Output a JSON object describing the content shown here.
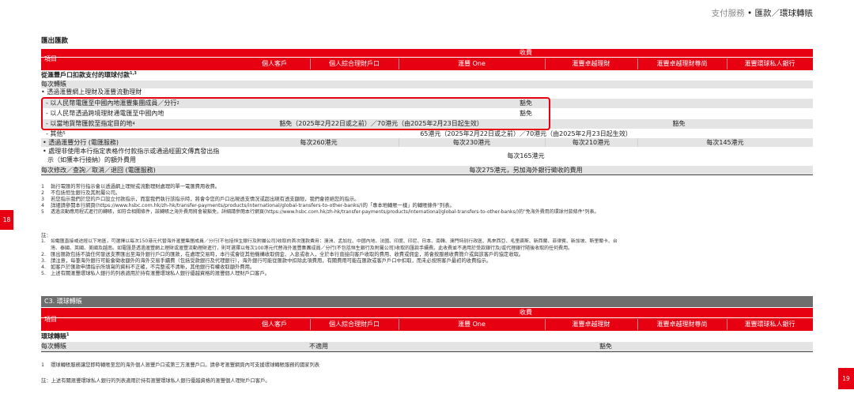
{
  "header": {
    "category": "支付服務",
    "bullet": "•",
    "title": "匯款／環球轉賬"
  },
  "page_numbers": {
    "left": "18",
    "right": "19"
  },
  "section1": {
    "title": "匯出匯款",
    "item_label": "項目",
    "fee_label": "收費",
    "columns": [
      "個人客戶",
      "個人綜合理財戶口",
      "滙豐 One",
      "滙豐卓越理財",
      "滙豐卓越理財尊尚",
      "滙豐環球私人銀行"
    ],
    "subheading": "從滙豐戶口扣款支付的環球付款",
    "subheading_sup": "1,3",
    "per_transfer": "每次轉賬",
    "online_line": "• 透過滙豐網上理財及滙豐流動理財",
    "rows": {
      "r1_label": "- 以人民幣電匯至中國內地滙豐集團成員／分行",
      "r1_sup": "2",
      "r1_value": "豁免",
      "r2_label": "- 以人民幣透過跨境理財通電匯至中國內地",
      "r2_value": "豁免",
      "r3_label": "- 以當地貨幣匯款至指定目的地",
      "r3_sup": "4",
      "r3_value_left": "豁免（2025年2月22日或之前）／70港元（由2025年2月23日起生效）",
      "r3_value_right": "豁免",
      "r4_label": "- 其他",
      "r4_sup": "5",
      "r4_value": "65港元（2025年2月22日或之前）／70港元（由2025年2月23日起生效）",
      "r5_label": "• 透過滙豐分行 (電匯服務)",
      "r5_v1": "每次260港元",
      "r5_v2": "每次230港元",
      "r5_v3": "每次210港元",
      "r5_v4": "每次145港元",
      "r6_label_1": "• 處理非使用本行指定表格作付款指示或通過經圖文傳真發出指",
      "r6_label_2": "示（如獲本行接納）的額外費用",
      "r6_value": "每次165港元",
      "r7_label": "每次修改／查詢／取消／退回 (電匯服務)",
      "r7_value": "每次275港元，另加海外銀行徵收的費用"
    },
    "footnotes": [
      {
        "n": "1",
        "text": "執行電匯的常行指示會以透過網上理財或流動理財處理的單一電匯費用收費。"
      },
      {
        "n": "2",
        "text": "不包括恒生銀行及其附屬公司。"
      },
      {
        "n": "3",
        "text": "若您指示我們於您的戶口設立付款指示，而當我們執行該指示時，將會令您的戶口出現透支情況或超出現有透支額限，我們會拒絕您的指示。"
      },
      {
        "n": "4",
        "text": "詳細請參閱本行網頁(https://www.hsbc.com.hk/zh-hk/transfer-payments/products/international/global-transfers-to-other-banks/)的「專本地轉賬一樣」的轉賬條件\"列表。"
      },
      {
        "n": "5",
        "text": "透過流動應用程式進行的轉賬，如符合相關條件，該轉賬之海外費用將會被豁免，詳細請參閱本行網頁(https://www.hsbc.com.hk/zh-hk/transfer-payments/products/international/global-transfers-to-other-banks/)的\"免海外費用的環球付款條件\"列表。"
      }
    ],
    "notes_title": "註：",
    "notes": [
      {
        "n": "1.",
        "text": "如電匯直接或途經以下地區，可選擇以每次150港元代替海外滙豐集團成員／分行(不包括恒生銀行及附屬公司)收取的首次匯款費用：澳洲、孟加拉、中國內地、法國、印度、印尼、日本、南韓、澳門特別行政區、馬來西亞、毛里裘斯、新西蘭、菲律賓、新加坡、斯里蘭卡、台"
      },
      {
        "n": "",
        "text": "灣、泰國、英國、美國及越南。如電匯是透過滙豐網上理財或滙豐流動理財進行，則可選擇以每次100港元代替海外滙豐集團成員／分行(不包括恒生銀行及附屬公司)收取的匯款手續費。此收費並不適用於受款銀行及/或代理銀行隨後收取的任何費用。"
      },
      {
        "n": "2.",
        "text": "匯出匯款包括不論任何發送支票匯出至海外銀行戶口的匯款，在處理交易時，本行或會從其他機構收取佣金、入息或收入，全於本行直接向客戶收取的費用、收費或佣金，將會按服務收費簡介或與該客戶的協定收取。"
      },
      {
        "n": "3.",
        "text": "請注意，每筆海外銀行可能會徵收額外的海外交易手續費（包括受款銀行及代理銀行），海外銀行可能從匯款中扣除此項費用，有關費用可能在匯款或客戶戶口中扣取，而未必按照客戶最初的收費指示。"
      },
      {
        "n": "4.",
        "text": "如客戶於匯款申請指示所填寫的資料不正確，不完整或不清晰，其他銀行有權收取額外費用。"
      },
      {
        "n": "5.",
        "text": "上述有關滙豐環球私人銀行的列表適用於持有滙豐環球私人銀行優越資格的滙豐個人理財戶口客戶。"
      }
    ]
  },
  "section2": {
    "title": "C3. 環球轉賬",
    "item_label": "項目",
    "fee_label": "收費",
    "columns": [
      "個人客戶",
      "個人綜合理財戶口",
      "滙豐 One",
      "滙豐卓越理財",
      "滙豐卓越理財尊尚",
      "滙豐環球私人銀行"
    ],
    "subheading": "環球轉賬",
    "subheading_sup": "1",
    "per_transfer": "每次轉賬",
    "value_left": "不適用",
    "value_right": "豁免",
    "footnote": {
      "n": "1",
      "text": "環球轉賬服務讓您即時轉賬至您的海外個人滙豐戶口或第三方滙豐戶口。請參考滙豐網頁內可支援環球轉賬服務的國家列表"
    },
    "note": "註：上述有關滙豐環球私人銀行的列表適用於持有滙豐環球私人銀行優越資格的滙豐個人理財戶口客戶。"
  },
  "colors": {
    "accent": "#e60012",
    "grey_bar": "#6e6e6e",
    "light_row": "#e4e4e4"
  }
}
